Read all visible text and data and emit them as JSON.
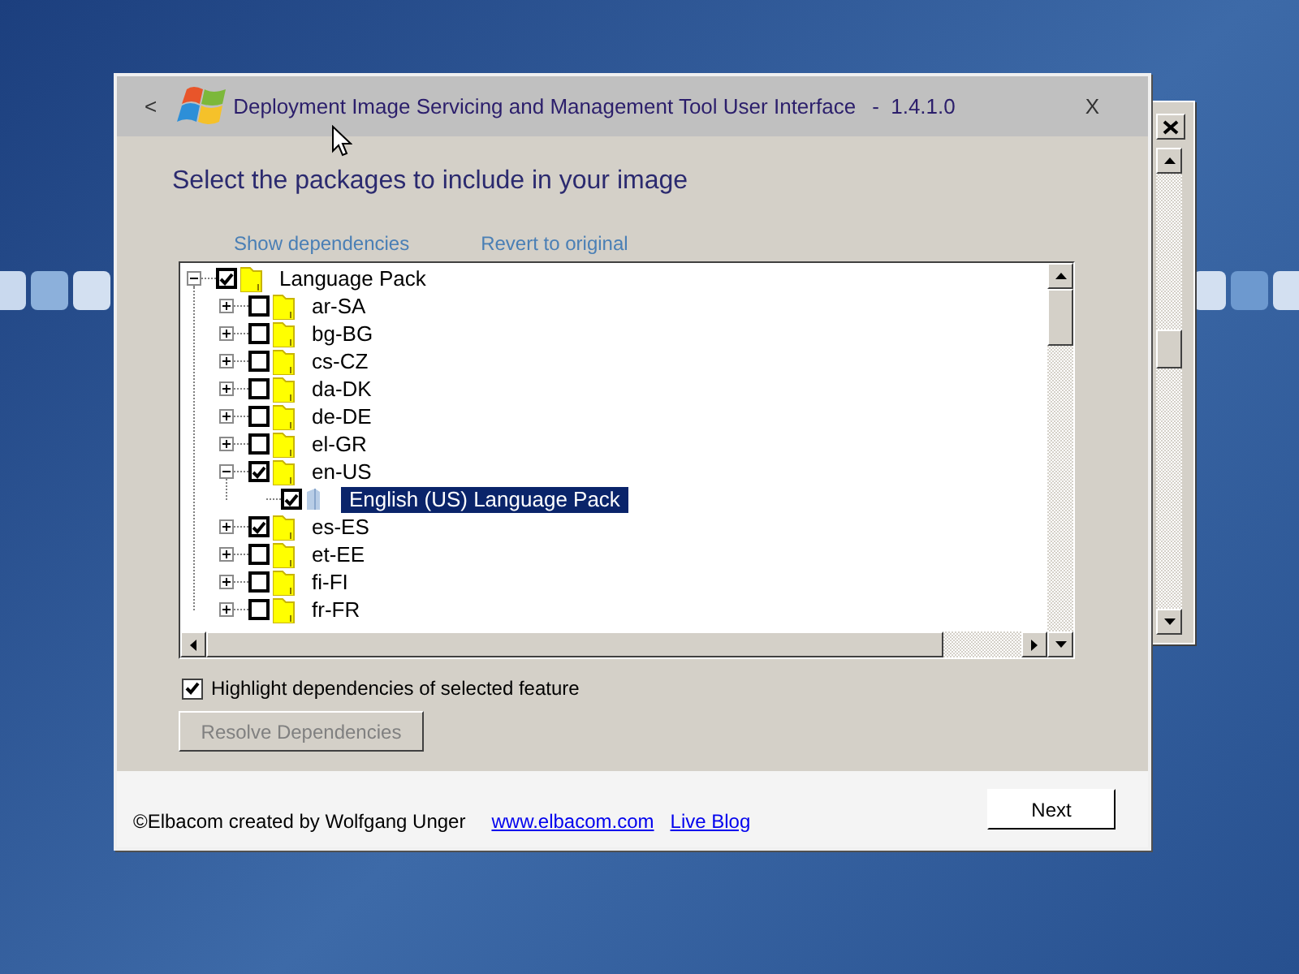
{
  "window": {
    "back": "<",
    "title": "Deployment Image Servicing and Management Tool User Interface",
    "version": "-  1.4.1.0",
    "close": "X"
  },
  "heading": "Select the packages to include in your image",
  "links": [
    "Show dependencies",
    "Revert to original"
  ],
  "tree": [
    {
      "label": "Language Pack",
      "kind": "folder",
      "checked": true,
      "expanded": true,
      "selected": false,
      "children": [
        {
          "label": "ar-SA",
          "kind": "folder",
          "checked": false,
          "expanded": false,
          "selected": false
        },
        {
          "label": "bg-BG",
          "kind": "folder",
          "checked": false,
          "expanded": false,
          "selected": false
        },
        {
          "label": "cs-CZ",
          "kind": "folder",
          "checked": false,
          "expanded": false,
          "selected": false
        },
        {
          "label": "da-DK",
          "kind": "folder",
          "checked": false,
          "expanded": false,
          "selected": false
        },
        {
          "label": "de-DE",
          "kind": "folder",
          "checked": false,
          "expanded": false,
          "selected": false
        },
        {
          "label": "el-GR",
          "kind": "folder",
          "checked": false,
          "expanded": false,
          "selected": false
        },
        {
          "label": "en-US",
          "kind": "folder",
          "checked": true,
          "expanded": true,
          "selected": false,
          "children": [
            {
              "label": "English (US) Language Pack",
              "kind": "package",
              "checked": true,
              "selected": true
            }
          ]
        },
        {
          "label": "es-ES",
          "kind": "folder",
          "checked": true,
          "expanded": false,
          "selected": false
        },
        {
          "label": "et-EE",
          "kind": "folder",
          "checked": false,
          "expanded": false,
          "selected": false
        },
        {
          "label": "fi-FI",
          "kind": "folder",
          "checked": false,
          "expanded": false,
          "selected": false
        },
        {
          "label": "fr-FR",
          "kind": "folder",
          "checked": false,
          "expanded": false,
          "selected": false
        }
      ]
    }
  ],
  "highlight_option": {
    "label": "Highlight dependencies of selected feature",
    "checked": true
  },
  "resolve_button": {
    "label": "Resolve Dependencies",
    "disabled": true
  },
  "footer": {
    "credit": "©Elbacom created by Wolfgang Unger",
    "links": [
      "www.elbacom.com",
      "Live Blog"
    ],
    "next_button": "Next"
  }
}
